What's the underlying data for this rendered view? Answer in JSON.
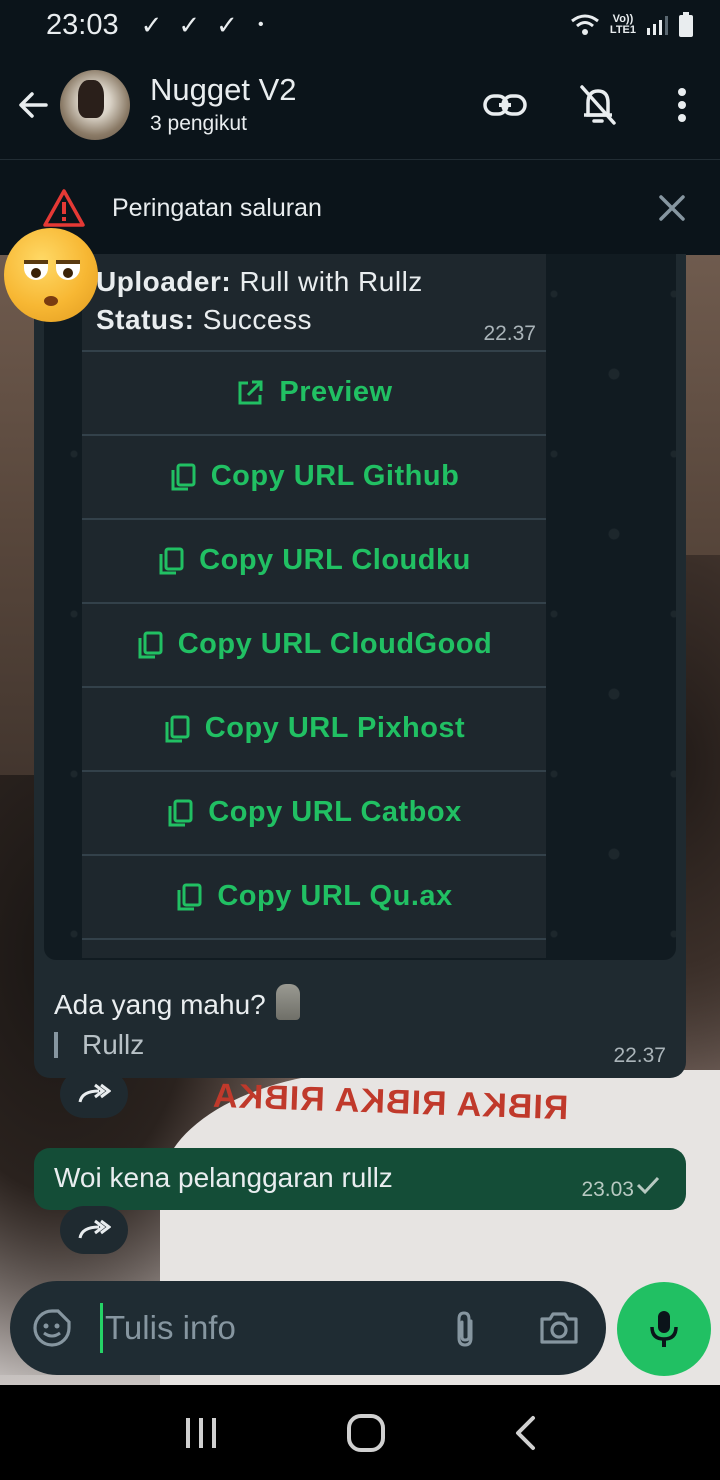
{
  "status_bar": {
    "time": "23:03",
    "checks": [
      "✓",
      "✓",
      "✓"
    ],
    "dot": "•",
    "network": [
      "Vo))",
      "LTE1"
    ]
  },
  "header": {
    "channel_name": "Nugget V2",
    "followers": "3 pengikut"
  },
  "warning": {
    "label": "Peringatan saluran"
  },
  "message": {
    "uploader_key": "Uploader:",
    "uploader_value": "Rull with Rullz",
    "status_key": "Status:",
    "status_value": "Success",
    "time": "22.37",
    "buttons": [
      {
        "label": "Preview",
        "icon": "external-link-icon"
      },
      {
        "label": "Copy URL Github",
        "icon": "copy-icon"
      },
      {
        "label": "Copy URL Cloudku",
        "icon": "copy-icon"
      },
      {
        "label": "Copy URL CloudGood",
        "icon": "copy-icon"
      },
      {
        "label": "Copy URL Pixhost",
        "icon": "copy-icon"
      },
      {
        "label": "Copy URL Catbox",
        "icon": "copy-icon"
      },
      {
        "label": "Copy URL Qu.ax",
        "icon": "copy-icon"
      }
    ],
    "caption": "Ada yang mahu?",
    "signature": "Rullz",
    "caption_time": "22.37"
  },
  "outgoing": {
    "text": "Woi kena pelanggaran rullz",
    "time": "23.03"
  },
  "input": {
    "placeholder": "Tulis info"
  },
  "colors": {
    "accent_green": "#21c063",
    "outgoing_bubble": "#144d37",
    "bg_dark": "#0b141a",
    "warning_red": "#e53935"
  }
}
